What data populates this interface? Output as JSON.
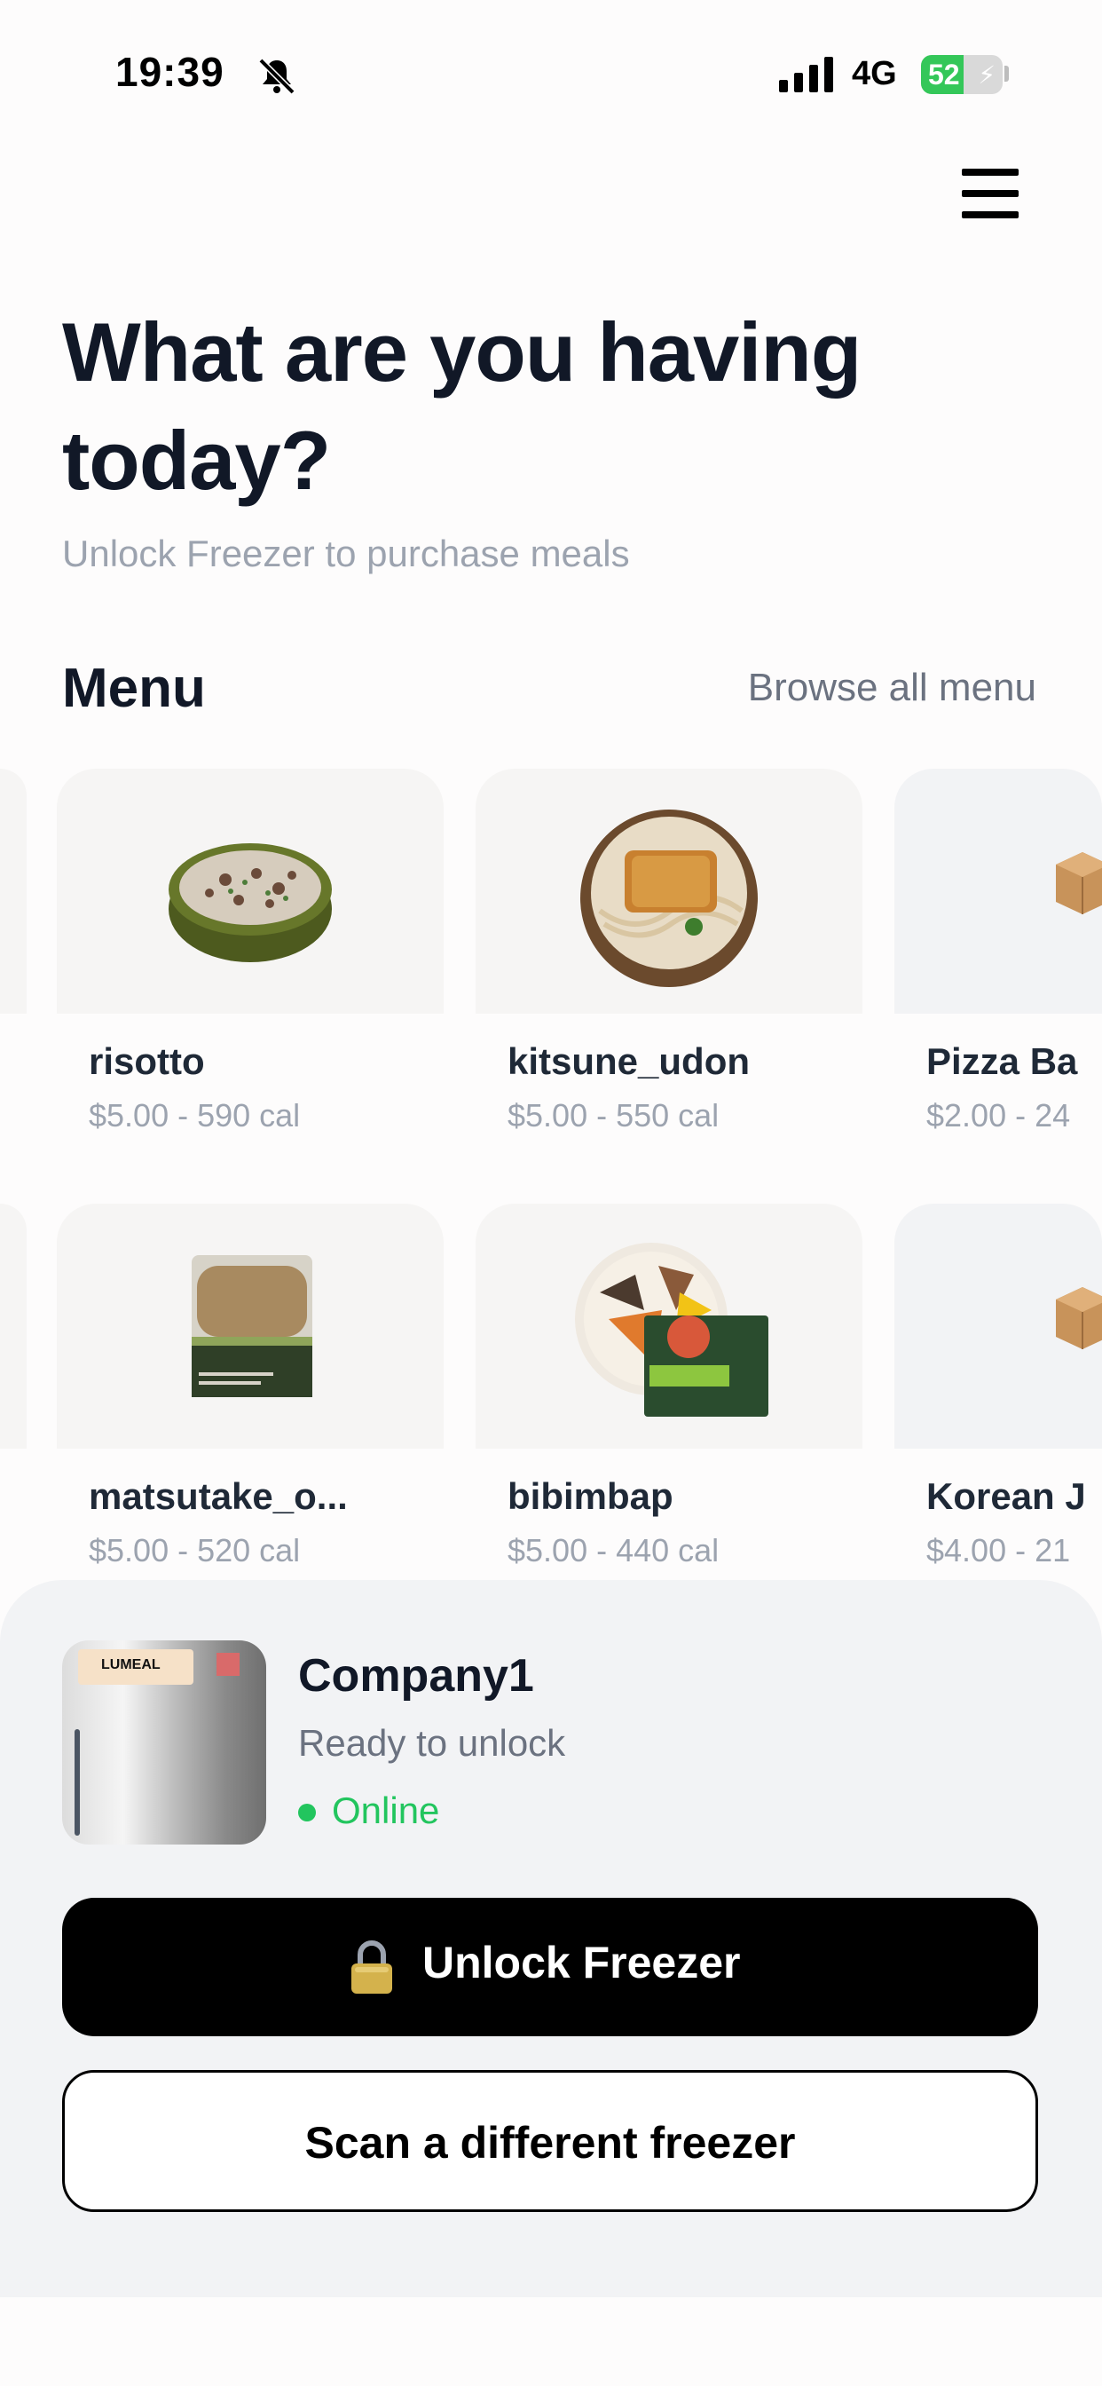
{
  "status_bar": {
    "time": "19:39",
    "network": "4G",
    "battery": "52",
    "battery_level": 0.52,
    "icons": [
      "bell-slash-icon",
      "signal-icon",
      "battery-charging-icon"
    ]
  },
  "header": {
    "menu_icon": "hamburger-menu-icon"
  },
  "hero": {
    "title": "What are you having today?",
    "subtitle": "Unlock Freezer to purchase meals"
  },
  "menu": {
    "title": "Menu",
    "browse_all": "Browse all menu",
    "items": [
      {
        "name": "risotto",
        "meta": "$5.00 - 590 cal",
        "image": "risotto-bowl"
      },
      {
        "name": "kitsune_udon",
        "meta": "$5.00 - 550 cal",
        "image": "udon-bowl"
      },
      {
        "name": "Pizza Ba",
        "meta": "$2.00 - 24",
        "image": "package-icon"
      },
      {
        "name": "matsutake_o...",
        "meta": "$5.00 - 520 cal",
        "image": "rice-ball-package"
      },
      {
        "name": "bibimbap",
        "meta": "$5.00 - 440 cal",
        "image": "bibimbap-bowl"
      },
      {
        "name": "Korean J",
        "meta": "$4.00 - 21",
        "image": "package-icon"
      }
    ]
  },
  "freezer": {
    "name": "Company1",
    "status": "Ready to unlock",
    "connection": "Online",
    "sticker_text": "LUMEAL",
    "unlock_label": "Unlock Freezer",
    "scan_label": "Scan a different freezer",
    "colors": {
      "online": "#22c55e",
      "primary_button": "#000000"
    }
  }
}
